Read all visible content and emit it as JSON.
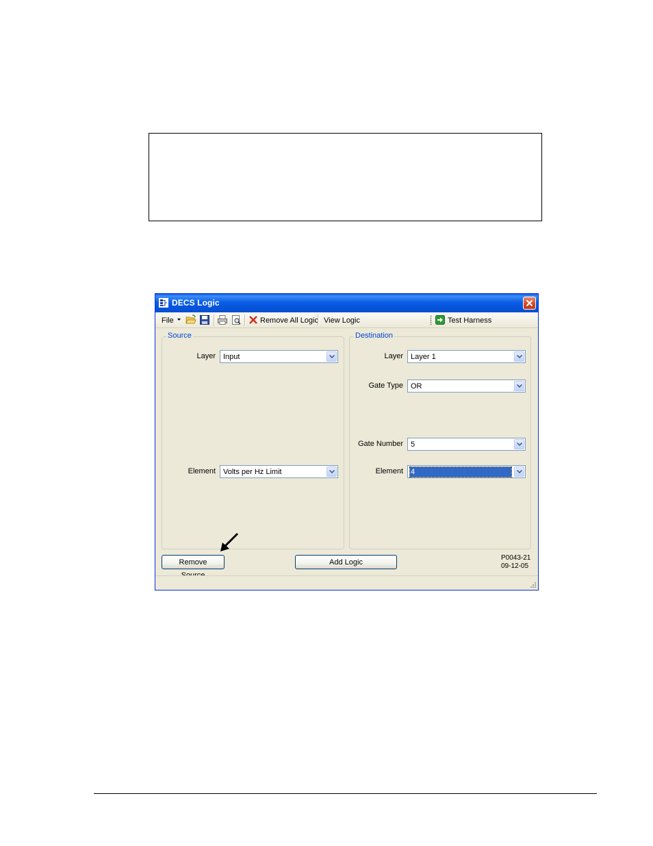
{
  "window": {
    "title": "DECS Logic",
    "colors": {
      "title_bar": "#0a5ee8",
      "face": "#ece9d8",
      "group_legend": "#0046d5",
      "close": "#d14424"
    }
  },
  "toolbar": {
    "file_label": "File",
    "remove_all_label": "Remove All Logic",
    "view_logic_label": "View Logic",
    "test_harness_label": "Test Harness",
    "icons": [
      "dropdown-arrow-icon",
      "open-folder-icon",
      "save-disk-icon",
      "print-icon",
      "print-preview-icon",
      "red-x-icon",
      "green-arrow-icon"
    ]
  },
  "source": {
    "legend": "Source",
    "layer_label": "Layer",
    "layer_value": "Input",
    "element_label": "Element",
    "element_value": "Volts per Hz Limit"
  },
  "destination": {
    "legend": "Destination",
    "layer_label": "Layer",
    "layer_value": "Layer 1",
    "gate_type_label": "Gate Type",
    "gate_type_value": "OR",
    "gate_number_label": "Gate Number",
    "gate_number_value": "5",
    "element_label": "Element",
    "element_value": "4"
  },
  "buttons": {
    "remove_source": "Remove Source",
    "add_logic": "Add Logic"
  },
  "figure_code": {
    "line1": "P0043-21",
    "line2": "09-12-05"
  }
}
